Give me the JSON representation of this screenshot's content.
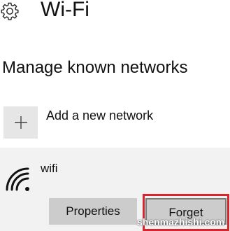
{
  "header": {
    "title": "Wi-Fi",
    "icon": "gear-icon"
  },
  "section": {
    "title": "Manage known networks"
  },
  "add_network": {
    "label": "Add a new network",
    "icon": "plus-icon"
  },
  "network": {
    "name": "wifi",
    "icon": "wifi-signal-icon",
    "buttons": {
      "properties": "Properties",
      "forget": "Forget"
    },
    "highlight_color": "#d9232d"
  },
  "watermark": "shenmazhishi.com"
}
